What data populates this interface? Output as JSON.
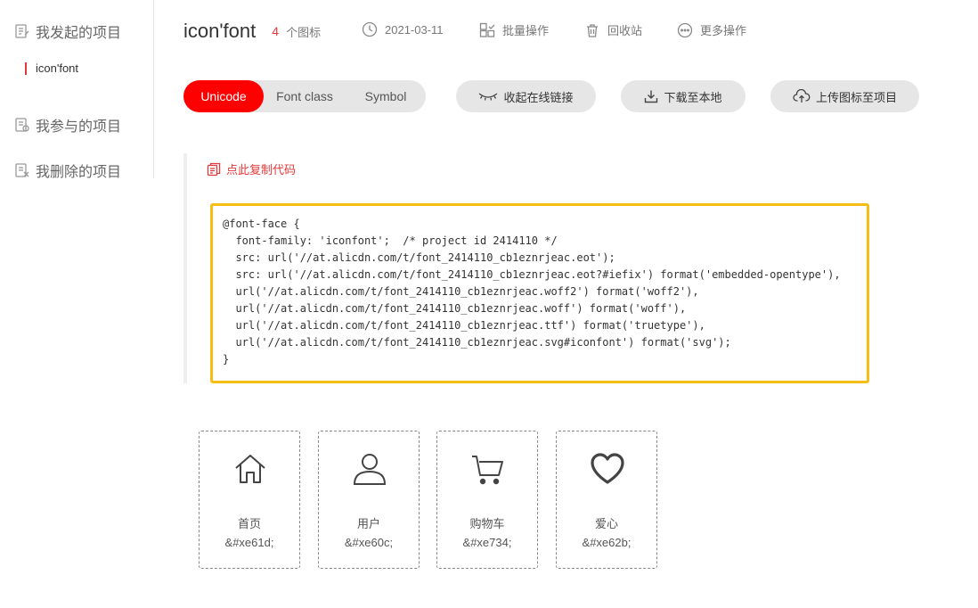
{
  "sidebar": {
    "items": [
      {
        "label": "我发起的项目",
        "icon": "project-list-icon"
      },
      {
        "label": "我参与的项目",
        "icon": "project-join-icon"
      },
      {
        "label": "我删除的项目",
        "icon": "project-deleted-icon"
      }
    ],
    "sub_item": "icon'font"
  },
  "header": {
    "title": "icon'font",
    "count": "4",
    "count_unit": "个图标",
    "date": "2021-03-11",
    "batch": "批量操作",
    "recycle": "回收站",
    "more": "更多操作"
  },
  "tabs": {
    "unicode": "Unicode",
    "fontclass": "Font class",
    "symbol": "Symbol"
  },
  "actions": {
    "collapse": "收起在线链接",
    "download": "下载至本地",
    "upload": "上传图标至项目"
  },
  "copy_link": "点此复制代码",
  "code": "@font-face {\n  font-family: 'iconfont';  /* project id 2414110 */\n  src: url('//at.alicdn.com/t/font_2414110_cb1eznrjeac.eot');\n  src: url('//at.alicdn.com/t/font_2414110_cb1eznrjeac.eot?#iefix') format('embedded-opentype'),\n  url('//at.alicdn.com/t/font_2414110_cb1eznrjeac.woff2') format('woff2'),\n  url('//at.alicdn.com/t/font_2414110_cb1eznrjeac.woff') format('woff'),\n  url('//at.alicdn.com/t/font_2414110_cb1eznrjeac.ttf') format('truetype'),\n  url('//at.alicdn.com/t/font_2414110_cb1eznrjeac.svg#iconfont') format('svg');\n}",
  "icons": [
    {
      "name": "首页",
      "code": "&#xe61d;",
      "icon": "home-icon"
    },
    {
      "name": "用户",
      "code": "&#xe60c;",
      "icon": "user-icon"
    },
    {
      "name": "购物车",
      "code": "&#xe734;",
      "icon": "cart-icon"
    },
    {
      "name": "爱心",
      "code": "&#xe62b;",
      "icon": "heart-icon"
    }
  ],
  "colors": {
    "accent": "#ff0000",
    "highlight_border": "#f6bd16",
    "pill_bg": "#e6e6e6"
  }
}
